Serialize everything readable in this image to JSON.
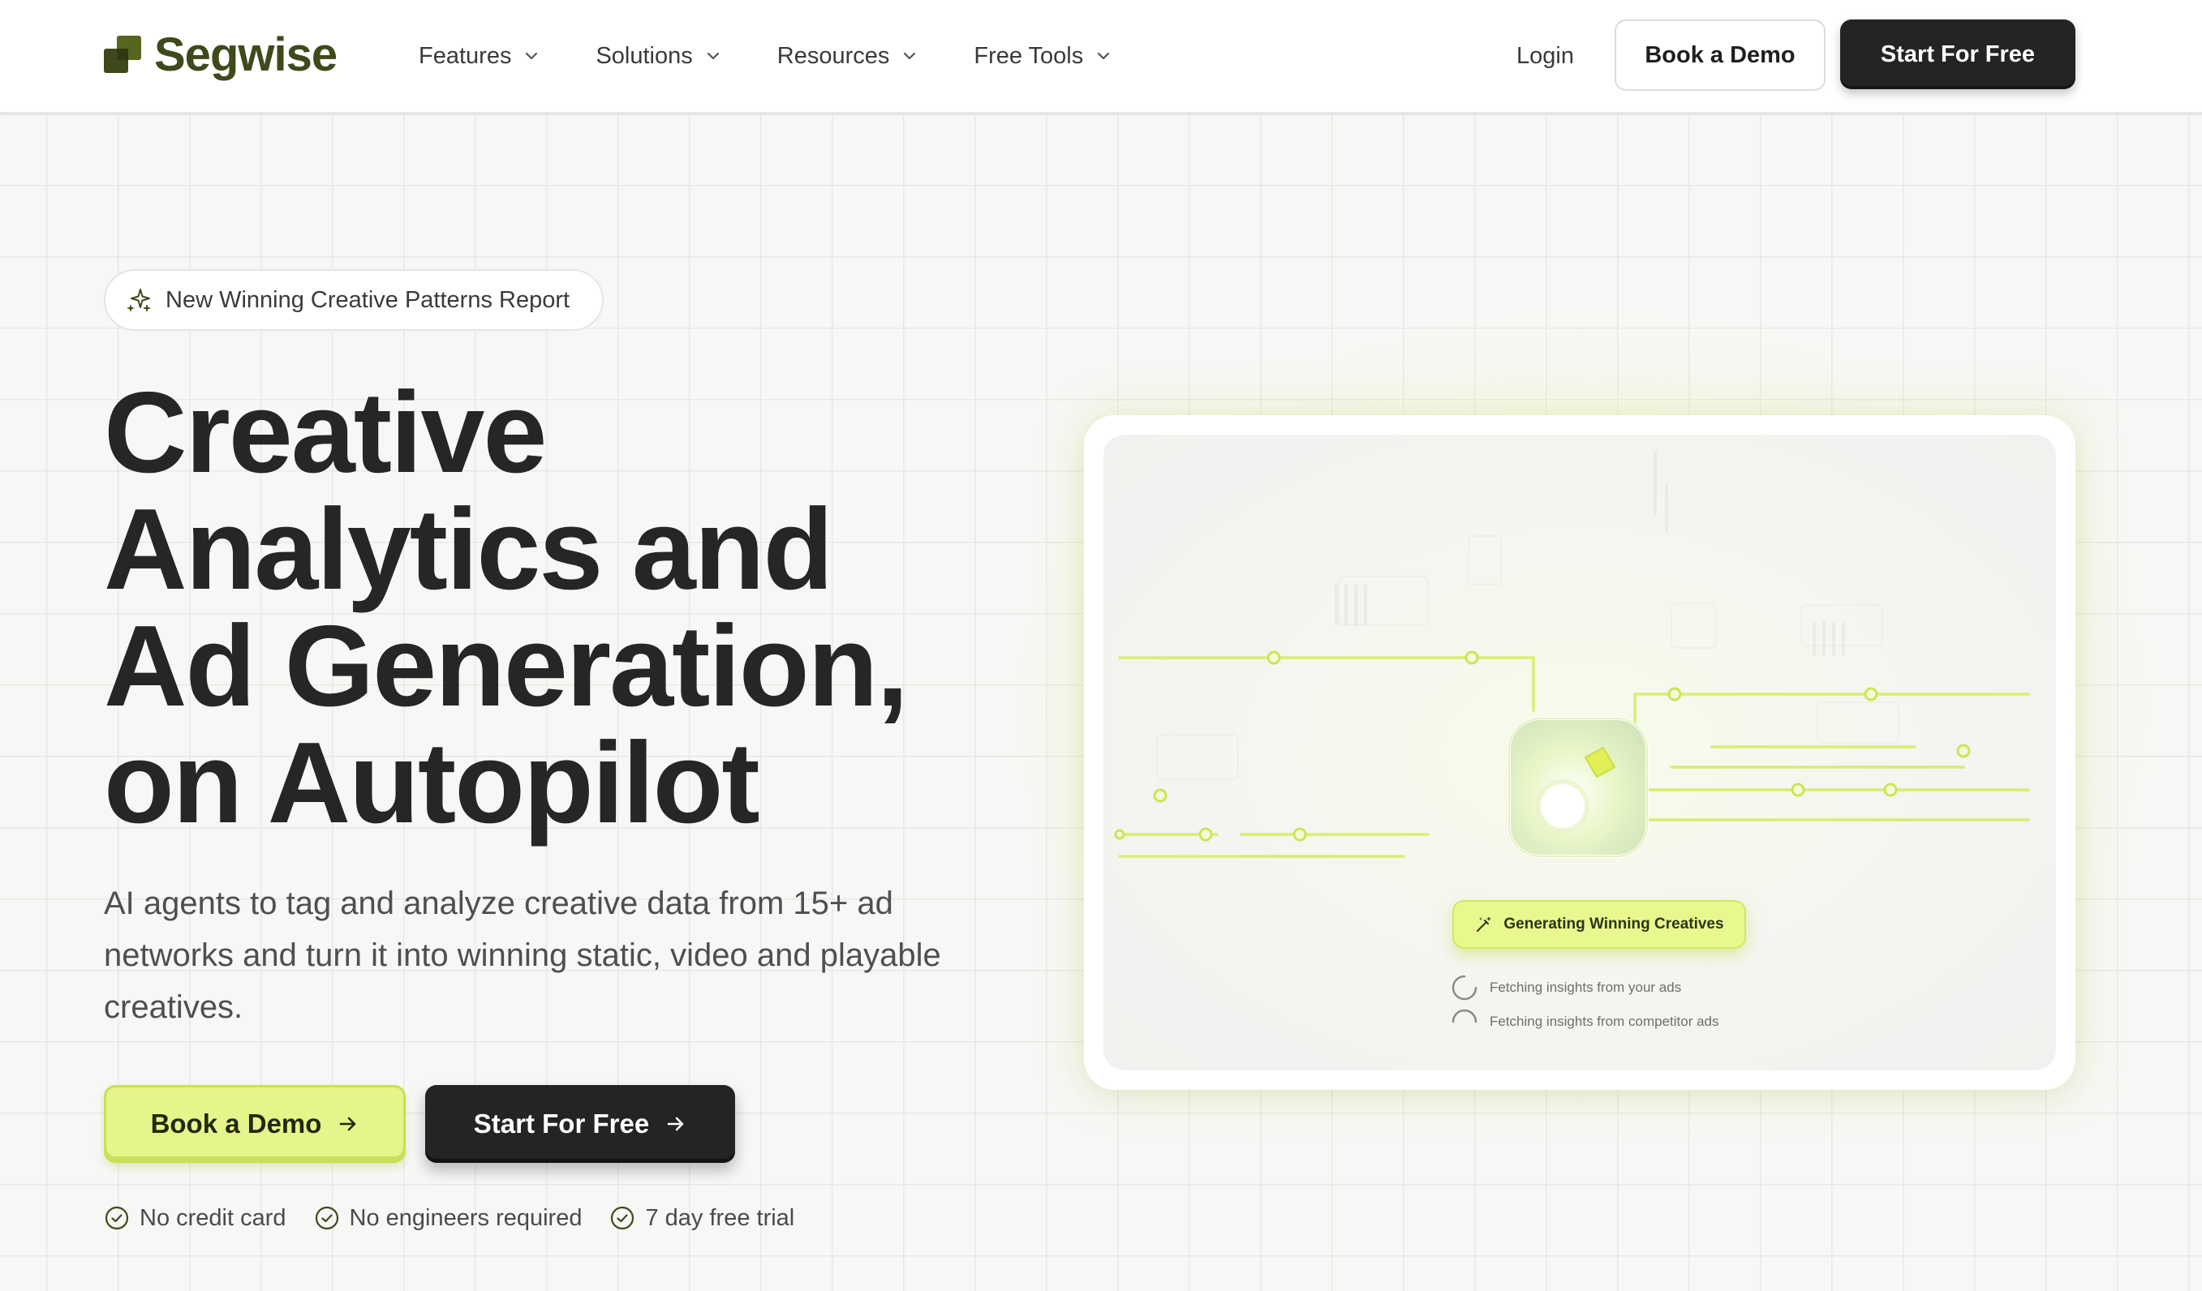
{
  "brand": {
    "name": "Segwise",
    "color": "#3e4a1c"
  },
  "nav": {
    "items": [
      {
        "label": "Features",
        "icon": "chevron-down-icon"
      },
      {
        "label": "Solutions",
        "icon": "chevron-down-icon"
      },
      {
        "label": "Resources",
        "icon": "chevron-down-icon"
      },
      {
        "label": "Free Tools",
        "icon": "chevron-down-icon"
      }
    ],
    "login": "Login",
    "book_demo": "Book a Demo",
    "start_free": "Start For Free"
  },
  "hero": {
    "badge": {
      "icon": "sparkles-icon",
      "label": "New Winning Creative Patterns Report"
    },
    "headline": [
      "Creative",
      "Analytics and",
      "Ad Generation,",
      "on Autopilot"
    ],
    "subtext": "AI agents to tag and analyze creative data from 15+ ad networks and turn it into winning static, video and playable creatives.",
    "cta_primary": {
      "label": "Book a Demo",
      "icon": "arrow-right-icon",
      "color": "#e6f48c"
    },
    "cta_secondary": {
      "label": "Start For Free",
      "icon": "arrow-right-icon",
      "color": "#242424"
    },
    "checks": [
      {
        "label": "No credit card",
        "icon": "check-circle-icon"
      },
      {
        "label": "No engineers required",
        "icon": "check-circle-icon"
      },
      {
        "label": "7 day free trial",
        "icon": "check-circle-icon"
      }
    ]
  },
  "preview": {
    "pill": {
      "label": "Generating Winning Creatives",
      "icon": "magic-wand-icon"
    },
    "statuses": [
      {
        "label": "Fetching insights from your ads",
        "icon": "spinner-icon"
      },
      {
        "label": "Fetching insights from competitor ads",
        "icon": "spinner-icon"
      }
    ],
    "accent": "#d8ef5a"
  }
}
